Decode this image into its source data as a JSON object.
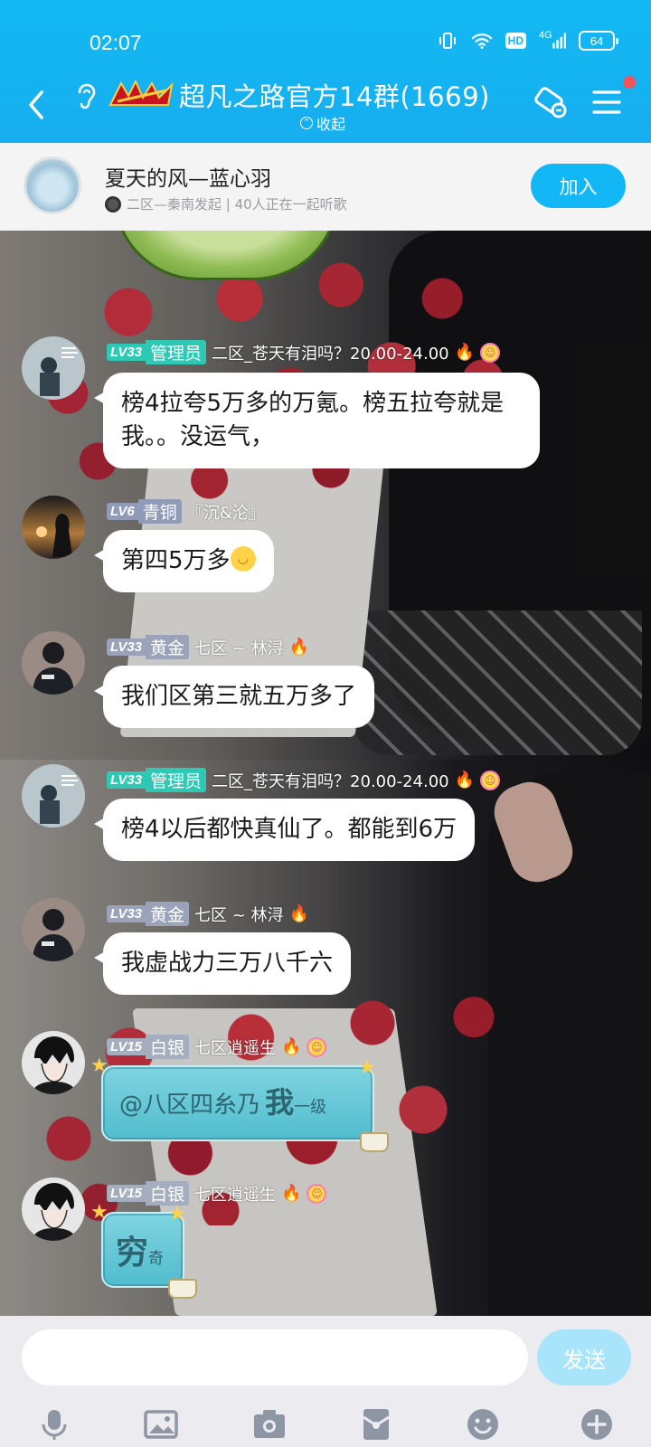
{
  "status_bar": {
    "time": "02:07",
    "network": "4G",
    "hd": "HD",
    "battery": "64"
  },
  "header": {
    "group_name": "超凡之路官方14群(1669)",
    "collapse_label": "收起",
    "accent_color": "#14b4f0"
  },
  "listen_together": {
    "song_title": "夏天的风—蓝心羽",
    "subtitle": "二区—秦南发起 | 40人正在一起听歌",
    "join_label": "加入"
  },
  "messages": [
    {
      "level": "LV33",
      "role": "管理员",
      "nickname": "二区_苍天有泪吗？20.00-24.00",
      "text": "榜4拉夸5万多的万氪。榜五拉夸就是我。。没运气，"
    },
    {
      "level": "LV6",
      "role": "青铜",
      "nickname": "『沉&沦』",
      "text": "第四5万多"
    },
    {
      "level": "LV33",
      "role": "黄金",
      "nickname": "七区 ~ 林浔",
      "text": "我们区第三就五万多了"
    },
    {
      "level": "LV33",
      "role": "管理员",
      "nickname": "二区_苍天有泪吗？20.00-24.00",
      "text": "榜4以后都快真仙了。都能到6万"
    },
    {
      "level": "LV33",
      "role": "黄金",
      "nickname": "七区 ~ 林浔",
      "text": "我虚战力三万八千六"
    },
    {
      "level": "LV15",
      "role": "白银",
      "nickname": "七区逍遥生",
      "text_prefix": "@八区四糸乃",
      "text_big": "我",
      "text_suffix": "一级"
    },
    {
      "level": "LV15",
      "role": "白银",
      "nickname": "七区逍遥生",
      "text_big": "穷",
      "text_suffix": "奇"
    }
  ],
  "input": {
    "send_label": "发送",
    "toolbar_icons": [
      "microphone-icon",
      "image-icon",
      "camera-icon",
      "red-packet-icon",
      "emoji-icon",
      "plus-icon"
    ]
  }
}
